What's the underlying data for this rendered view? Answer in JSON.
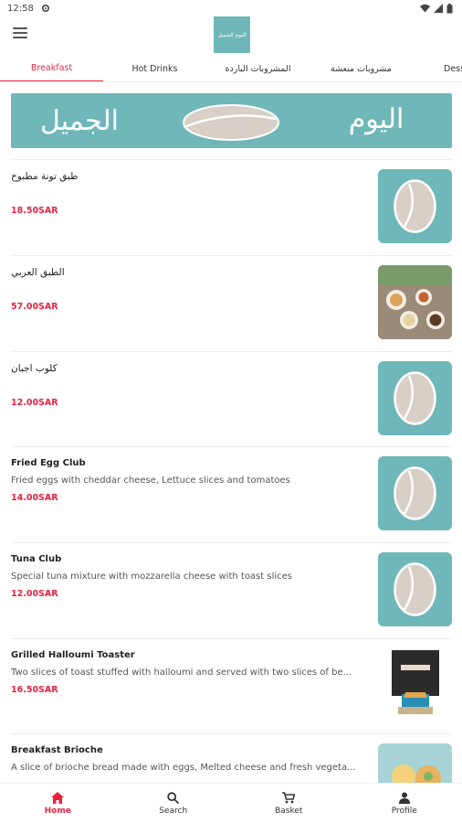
{
  "status": {
    "time": "12:58"
  },
  "header": {
    "logo_text": "اليوم الجميل"
  },
  "tabs": [
    "Breakfast",
    "Hot Drinks",
    "المشروبات الباردة",
    "مشروبات منعشة",
    "Desserts"
  ],
  "banner": {
    "text_left": "الجميل",
    "text_right": "اليوم"
  },
  "items": [
    {
      "title": "طبق تونة مطبوخ",
      "description": "",
      "price": "18.50SAR",
      "image": "logo-bean"
    },
    {
      "title": "الطبق العربي",
      "description": "",
      "price": "57.00SAR",
      "image": "photo-arabic-plate"
    },
    {
      "title": "كلوب اجبان",
      "description": "",
      "price": "12.00SAR",
      "image": "logo-bean"
    },
    {
      "title": "Fried Egg Club",
      "description": "Fried eggs with cheddar cheese, Lettuce slices and tomatoes",
      "price": "14.00SAR",
      "image": "logo-bean"
    },
    {
      "title": "Tuna Club",
      "description": "Special tuna mixture with mozzarella cheese with toast slices",
      "price": "12.00SAR",
      "image": "logo-bean"
    },
    {
      "title": "Grilled Halloumi Toaster",
      "description": "Two slices of toast stuffed with halloumi and served with two slices of be...",
      "price": "16.50SAR",
      "image": "photo-halloumi"
    },
    {
      "title": "Breakfast Brioche",
      "description": "A slice of brioche bread made with eggs, Melted cheese and fresh vegeta...",
      "price": "",
      "image": "photo-brioche"
    }
  ],
  "bottom_nav": [
    {
      "label": "Home",
      "icon": "home-icon"
    },
    {
      "label": "Search",
      "icon": "search-icon"
    },
    {
      "label": "Basket",
      "icon": "cart-icon"
    },
    {
      "label": "Profile",
      "icon": "person-icon"
    }
  ],
  "colors": {
    "accent": "#e8233e",
    "brand_teal": "#6fb7b8"
  }
}
